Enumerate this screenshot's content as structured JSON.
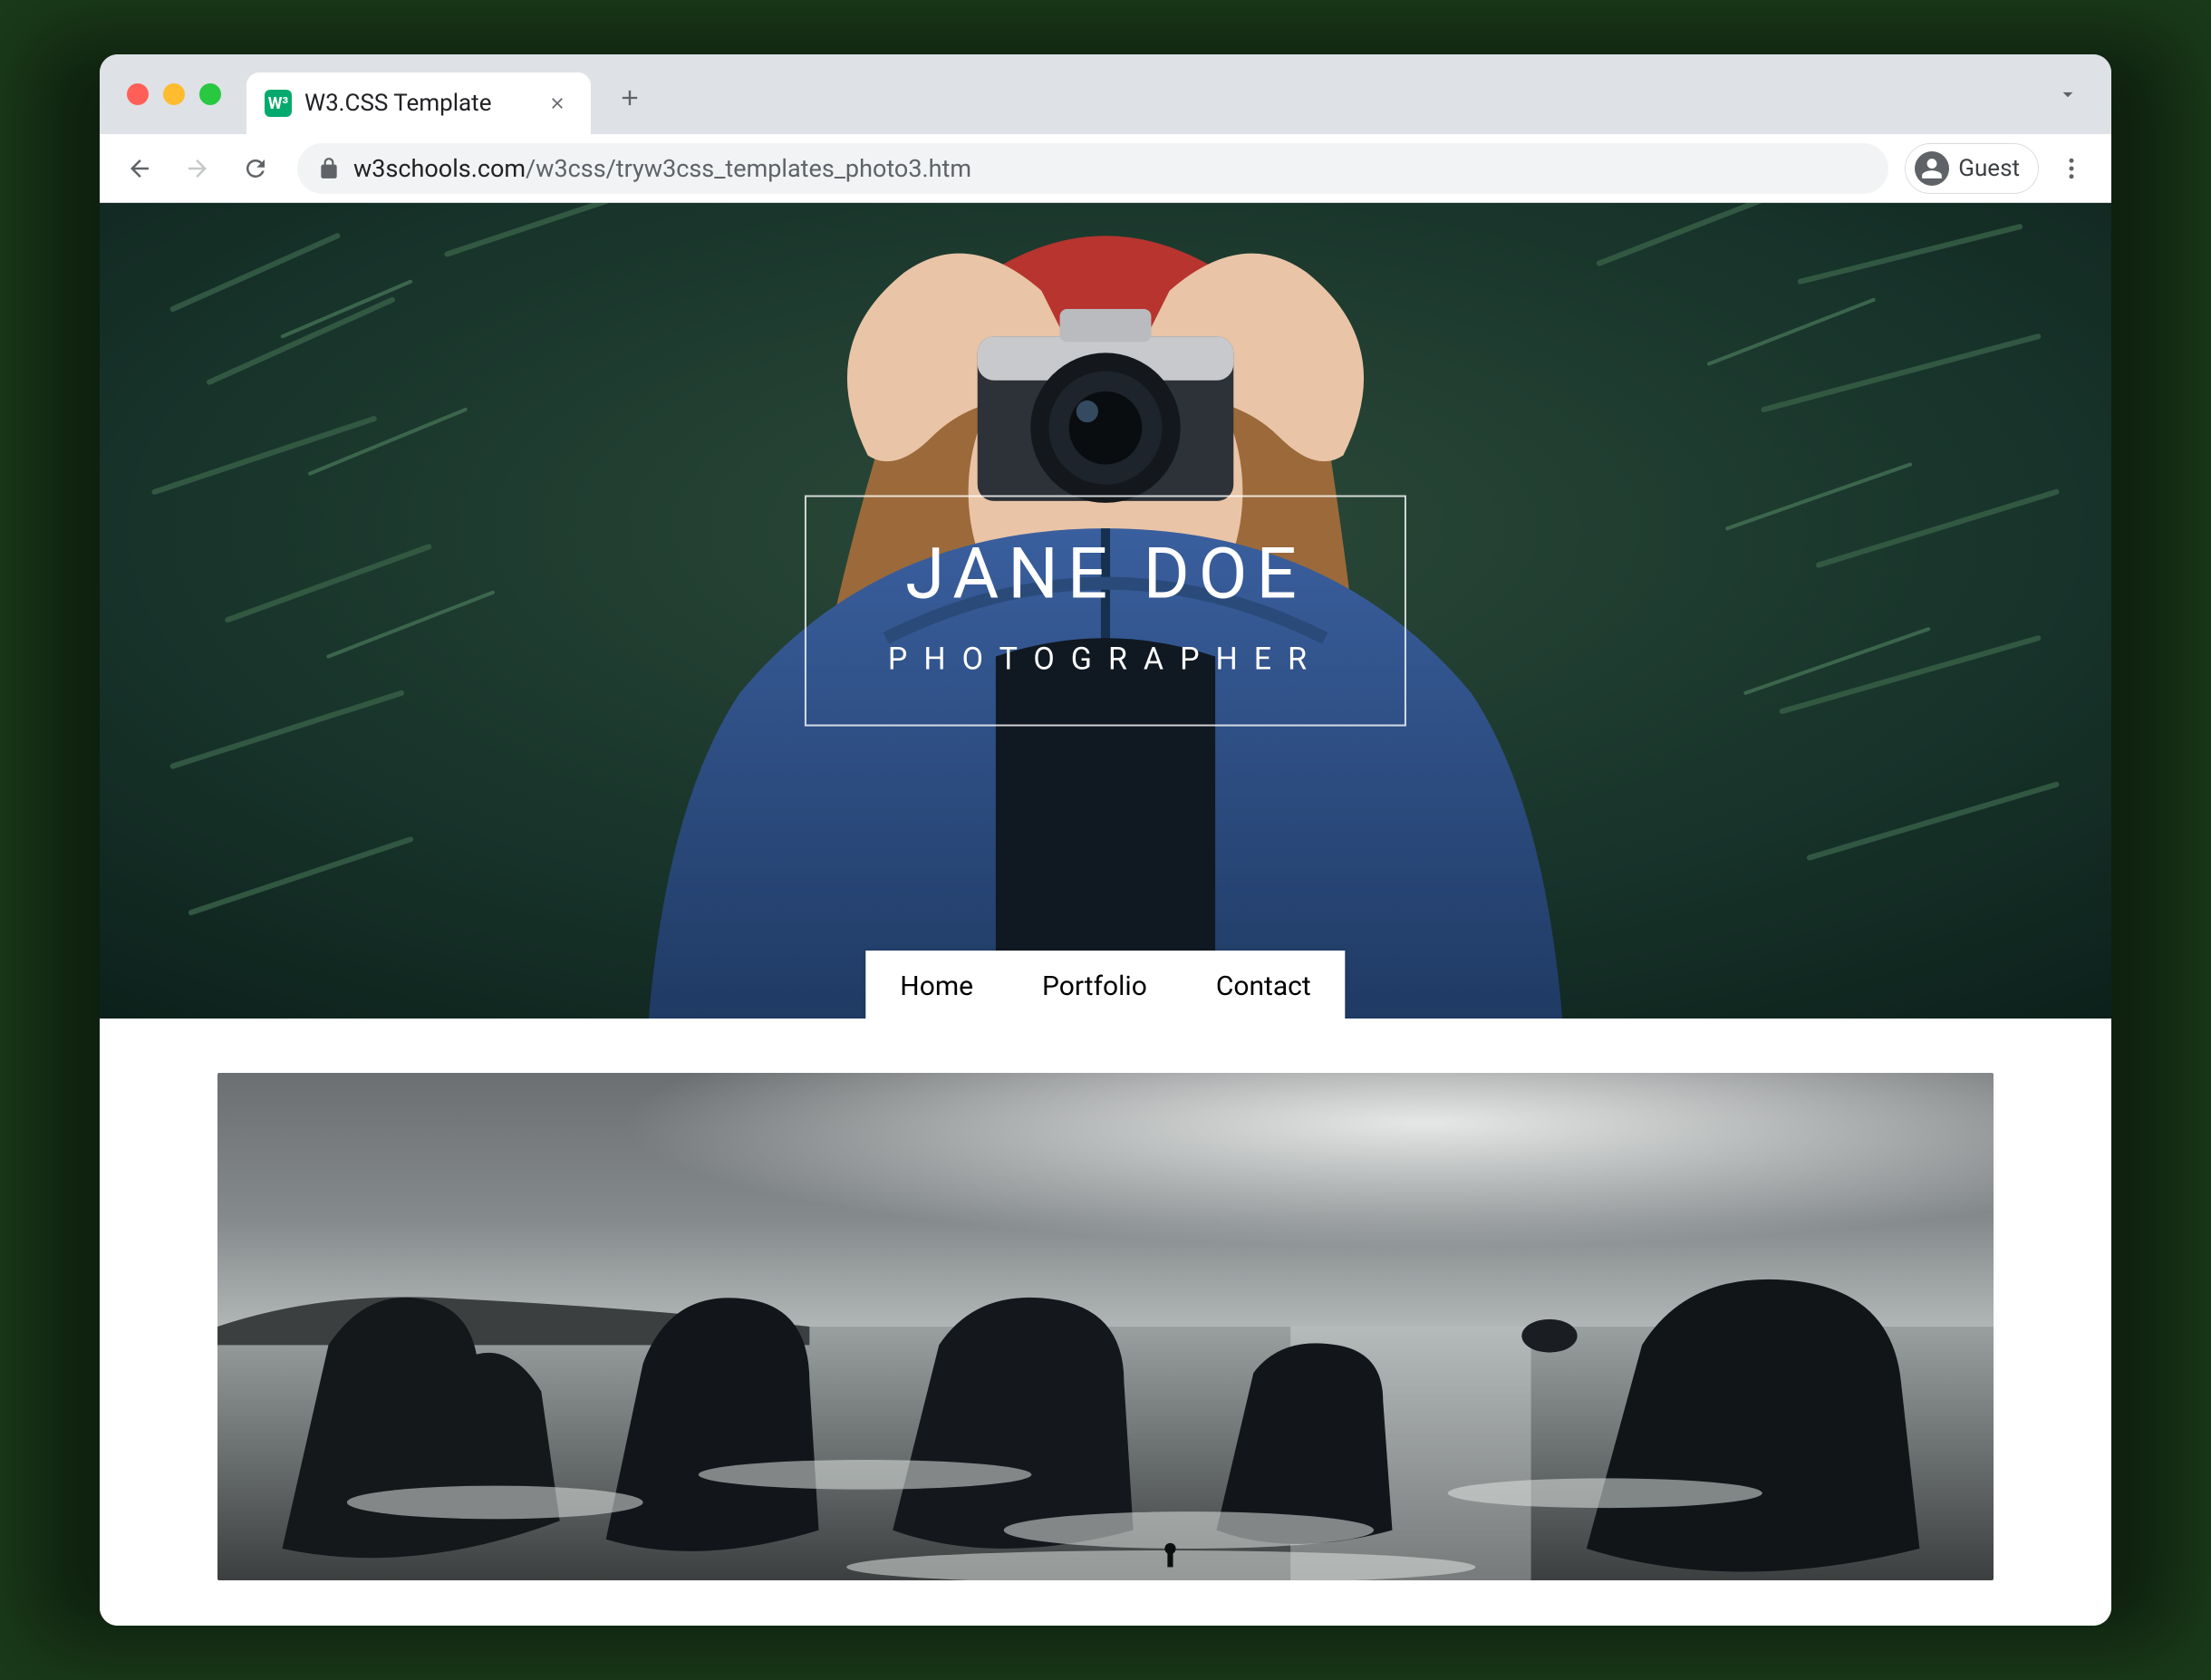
{
  "browser": {
    "tab_title": "W3.CSS Template",
    "favicon_letter": "W³",
    "url_host": "w3schools.com",
    "url_path": "/w3css/tryw3css_templates_photo3.htm",
    "profile_label": "Guest"
  },
  "hero": {
    "name": "JANE DOE",
    "role": "PHOTOGRAPHER"
  },
  "nav": {
    "items": [
      {
        "label": "Home"
      },
      {
        "label": "Portfolio"
      },
      {
        "label": "Contact"
      }
    ]
  }
}
